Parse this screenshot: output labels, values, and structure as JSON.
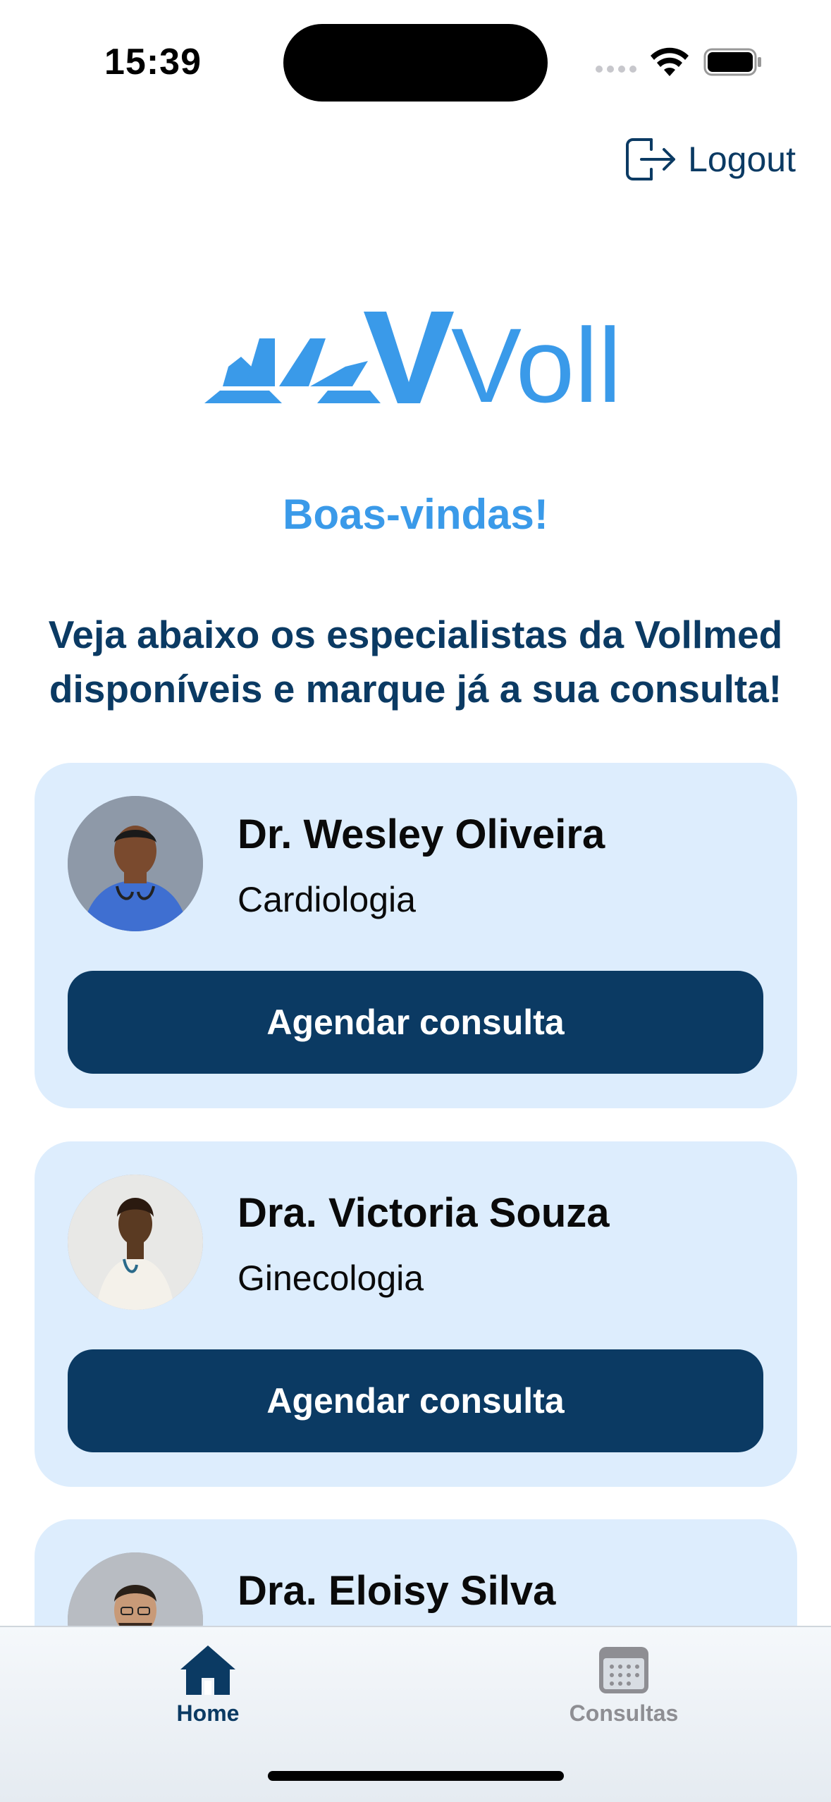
{
  "status_bar": {
    "time": "15:39"
  },
  "header": {
    "logout_label": "Logout"
  },
  "logo": {
    "text": "Voll",
    "color": "#3a9ae9"
  },
  "welcome": "Boas-vindas!",
  "intro": "Veja abaixo os especialistas da Vollmed disponíveis e marque já a sua consulta!",
  "specialists": [
    {
      "name": "Dr. Wesley Oliveira",
      "specialty": "Cardiologia",
      "button_label": "Agendar consulta"
    },
    {
      "name": "Dra. Victoria Souza",
      "specialty": "Ginecologia",
      "button_label": "Agendar consulta"
    },
    {
      "name": "Dra. Eloisy Silva",
      "specialty": "",
      "button_label": ""
    }
  ],
  "tabs": [
    {
      "label": "Home",
      "icon": "home-icon",
      "active": true
    },
    {
      "label": "Consultas",
      "icon": "calendar-icon",
      "active": false
    }
  ],
  "colors": {
    "primary": "#0b3a63",
    "accent": "#3a9ae9",
    "card_bg": "#ddedfd"
  }
}
